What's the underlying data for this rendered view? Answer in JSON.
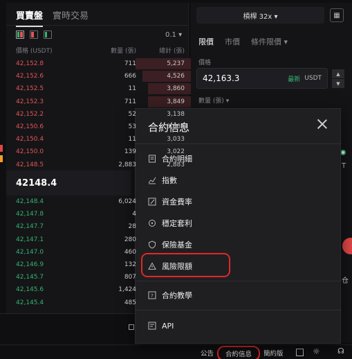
{
  "orderbook": {
    "tabs": [
      "買賣盤",
      "實時交易"
    ],
    "precision": "0.1 ▾",
    "columns": [
      "價格 (USDT)",
      "數量 (張)",
      "總計 (張)"
    ],
    "asks": [
      {
        "price": "42,152.8",
        "qty": "711",
        "total": "5,237",
        "depth": 0.33
      },
      {
        "price": "42,152.6",
        "qty": "666",
        "total": "4,526",
        "depth": 0.29
      },
      {
        "price": "42,152.5",
        "qty": "11",
        "total": "3,860",
        "depth": 0.26
      },
      {
        "price": "42,152.3",
        "qty": "711",
        "total": "3,849",
        "depth": 0.26
      },
      {
        "price": "42,152.2",
        "qty": "52",
        "total": "3,138",
        "depth": 0.21
      },
      {
        "price": "42,150.6",
        "qty": "53",
        "total": "3,086",
        "depth": 0.21
      },
      {
        "price": "42,150.4",
        "qty": "11",
        "total": "3,033",
        "depth": 0.21
      },
      {
        "price": "42,150.0",
        "qty": "139",
        "total": "3,022",
        "depth": 0.2
      },
      {
        "price": "42,148.5",
        "qty": "2,883",
        "total": "2,883",
        "depth": 0.2
      }
    ],
    "last_price": "42148.4",
    "bids": [
      {
        "price": "42,148.4",
        "qty": "6,024",
        "depth": 0
      },
      {
        "price": "42,147.8",
        "qty": "4",
        "depth": 0
      },
      {
        "price": "42,147.7",
        "qty": "28",
        "depth": 0
      },
      {
        "price": "42,147.1",
        "qty": "280",
        "depth": 0
      },
      {
        "price": "42,147.0",
        "qty": "460",
        "depth": 0
      },
      {
        "price": "42,146.9",
        "qty": "132",
        "depth": 0
      },
      {
        "price": "42,145.7",
        "qty": "807",
        "depth": 0
      },
      {
        "price": "42,145.6",
        "qty": "1,424",
        "depth": 0
      },
      {
        "price": "42,145.4",
        "qty": "485",
        "depth": 0
      }
    ]
  },
  "trade": {
    "leverage": "槓桿  32x  ▾",
    "order_tabs": [
      "限價",
      "市價",
      "條件限價 ▾"
    ],
    "price_label": "價格",
    "price_value": "42,163.3",
    "latest_label": "最新",
    "unit": "USDT",
    "qty_label": "數量 (張) ▾"
  },
  "modal": {
    "title": "合約信息",
    "items": [
      {
        "label": "合約明細",
        "icon": "document-icon"
      },
      {
        "label": "指數",
        "icon": "line-chart-icon"
      },
      {
        "label": "資金費率",
        "icon": "percent-icon"
      },
      {
        "label": "穩定套利",
        "icon": "refresh-icon"
      },
      {
        "label": "保險基金",
        "icon": "shield-icon"
      },
      {
        "label": "風險限額",
        "icon": "warning-icon"
      },
      {
        "label": "合約教學",
        "icon": "help-icon"
      },
      {
        "label": "API",
        "icon": "api-icon"
      }
    ]
  },
  "footer": {
    "announcement": "公告",
    "contract_info": "合約信息",
    "simple_mode": "簡約版"
  },
  "colors": {
    "ask": "#e25555",
    "bid": "#35b36f",
    "highlight": "#e02828"
  }
}
